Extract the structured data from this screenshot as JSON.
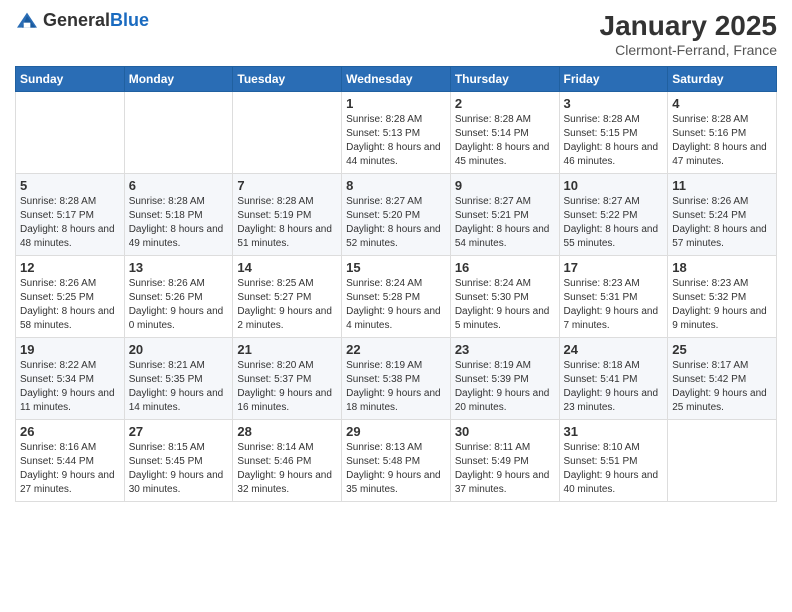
{
  "header": {
    "logo": {
      "general": "General",
      "blue": "Blue"
    },
    "title": "January 2025",
    "subtitle": "Clermont-Ferrand, France"
  },
  "weekdays": [
    "Sunday",
    "Monday",
    "Tuesday",
    "Wednesday",
    "Thursday",
    "Friday",
    "Saturday"
  ],
  "weeks": [
    [
      {
        "day": "",
        "info": ""
      },
      {
        "day": "",
        "info": ""
      },
      {
        "day": "",
        "info": ""
      },
      {
        "day": "1",
        "info": "Sunrise: 8:28 AM\nSunset: 5:13 PM\nDaylight: 8 hours\nand 44 minutes."
      },
      {
        "day": "2",
        "info": "Sunrise: 8:28 AM\nSunset: 5:14 PM\nDaylight: 8 hours\nand 45 minutes."
      },
      {
        "day": "3",
        "info": "Sunrise: 8:28 AM\nSunset: 5:15 PM\nDaylight: 8 hours\nand 46 minutes."
      },
      {
        "day": "4",
        "info": "Sunrise: 8:28 AM\nSunset: 5:16 PM\nDaylight: 8 hours\nand 47 minutes."
      }
    ],
    [
      {
        "day": "5",
        "info": "Sunrise: 8:28 AM\nSunset: 5:17 PM\nDaylight: 8 hours\nand 48 minutes."
      },
      {
        "day": "6",
        "info": "Sunrise: 8:28 AM\nSunset: 5:18 PM\nDaylight: 8 hours\nand 49 minutes."
      },
      {
        "day": "7",
        "info": "Sunrise: 8:28 AM\nSunset: 5:19 PM\nDaylight: 8 hours\nand 51 minutes."
      },
      {
        "day": "8",
        "info": "Sunrise: 8:27 AM\nSunset: 5:20 PM\nDaylight: 8 hours\nand 52 minutes."
      },
      {
        "day": "9",
        "info": "Sunrise: 8:27 AM\nSunset: 5:21 PM\nDaylight: 8 hours\nand 54 minutes."
      },
      {
        "day": "10",
        "info": "Sunrise: 8:27 AM\nSunset: 5:22 PM\nDaylight: 8 hours\nand 55 minutes."
      },
      {
        "day": "11",
        "info": "Sunrise: 8:26 AM\nSunset: 5:24 PM\nDaylight: 8 hours\nand 57 minutes."
      }
    ],
    [
      {
        "day": "12",
        "info": "Sunrise: 8:26 AM\nSunset: 5:25 PM\nDaylight: 8 hours\nand 58 minutes."
      },
      {
        "day": "13",
        "info": "Sunrise: 8:26 AM\nSunset: 5:26 PM\nDaylight: 9 hours\nand 0 minutes."
      },
      {
        "day": "14",
        "info": "Sunrise: 8:25 AM\nSunset: 5:27 PM\nDaylight: 9 hours\nand 2 minutes."
      },
      {
        "day": "15",
        "info": "Sunrise: 8:24 AM\nSunset: 5:28 PM\nDaylight: 9 hours\nand 4 minutes."
      },
      {
        "day": "16",
        "info": "Sunrise: 8:24 AM\nSunset: 5:30 PM\nDaylight: 9 hours\nand 5 minutes."
      },
      {
        "day": "17",
        "info": "Sunrise: 8:23 AM\nSunset: 5:31 PM\nDaylight: 9 hours\nand 7 minutes."
      },
      {
        "day": "18",
        "info": "Sunrise: 8:23 AM\nSunset: 5:32 PM\nDaylight: 9 hours\nand 9 minutes."
      }
    ],
    [
      {
        "day": "19",
        "info": "Sunrise: 8:22 AM\nSunset: 5:34 PM\nDaylight: 9 hours\nand 11 minutes."
      },
      {
        "day": "20",
        "info": "Sunrise: 8:21 AM\nSunset: 5:35 PM\nDaylight: 9 hours\nand 14 minutes."
      },
      {
        "day": "21",
        "info": "Sunrise: 8:20 AM\nSunset: 5:37 PM\nDaylight: 9 hours\nand 16 minutes."
      },
      {
        "day": "22",
        "info": "Sunrise: 8:19 AM\nSunset: 5:38 PM\nDaylight: 9 hours\nand 18 minutes."
      },
      {
        "day": "23",
        "info": "Sunrise: 8:19 AM\nSunset: 5:39 PM\nDaylight: 9 hours\nand 20 minutes."
      },
      {
        "day": "24",
        "info": "Sunrise: 8:18 AM\nSunset: 5:41 PM\nDaylight: 9 hours\nand 23 minutes."
      },
      {
        "day": "25",
        "info": "Sunrise: 8:17 AM\nSunset: 5:42 PM\nDaylight: 9 hours\nand 25 minutes."
      }
    ],
    [
      {
        "day": "26",
        "info": "Sunrise: 8:16 AM\nSunset: 5:44 PM\nDaylight: 9 hours\nand 27 minutes."
      },
      {
        "day": "27",
        "info": "Sunrise: 8:15 AM\nSunset: 5:45 PM\nDaylight: 9 hours\nand 30 minutes."
      },
      {
        "day": "28",
        "info": "Sunrise: 8:14 AM\nSunset: 5:46 PM\nDaylight: 9 hours\nand 32 minutes."
      },
      {
        "day": "29",
        "info": "Sunrise: 8:13 AM\nSunset: 5:48 PM\nDaylight: 9 hours\nand 35 minutes."
      },
      {
        "day": "30",
        "info": "Sunrise: 8:11 AM\nSunset: 5:49 PM\nDaylight: 9 hours\nand 37 minutes."
      },
      {
        "day": "31",
        "info": "Sunrise: 8:10 AM\nSunset: 5:51 PM\nDaylight: 9 hours\nand 40 minutes."
      },
      {
        "day": "",
        "info": ""
      }
    ]
  ]
}
